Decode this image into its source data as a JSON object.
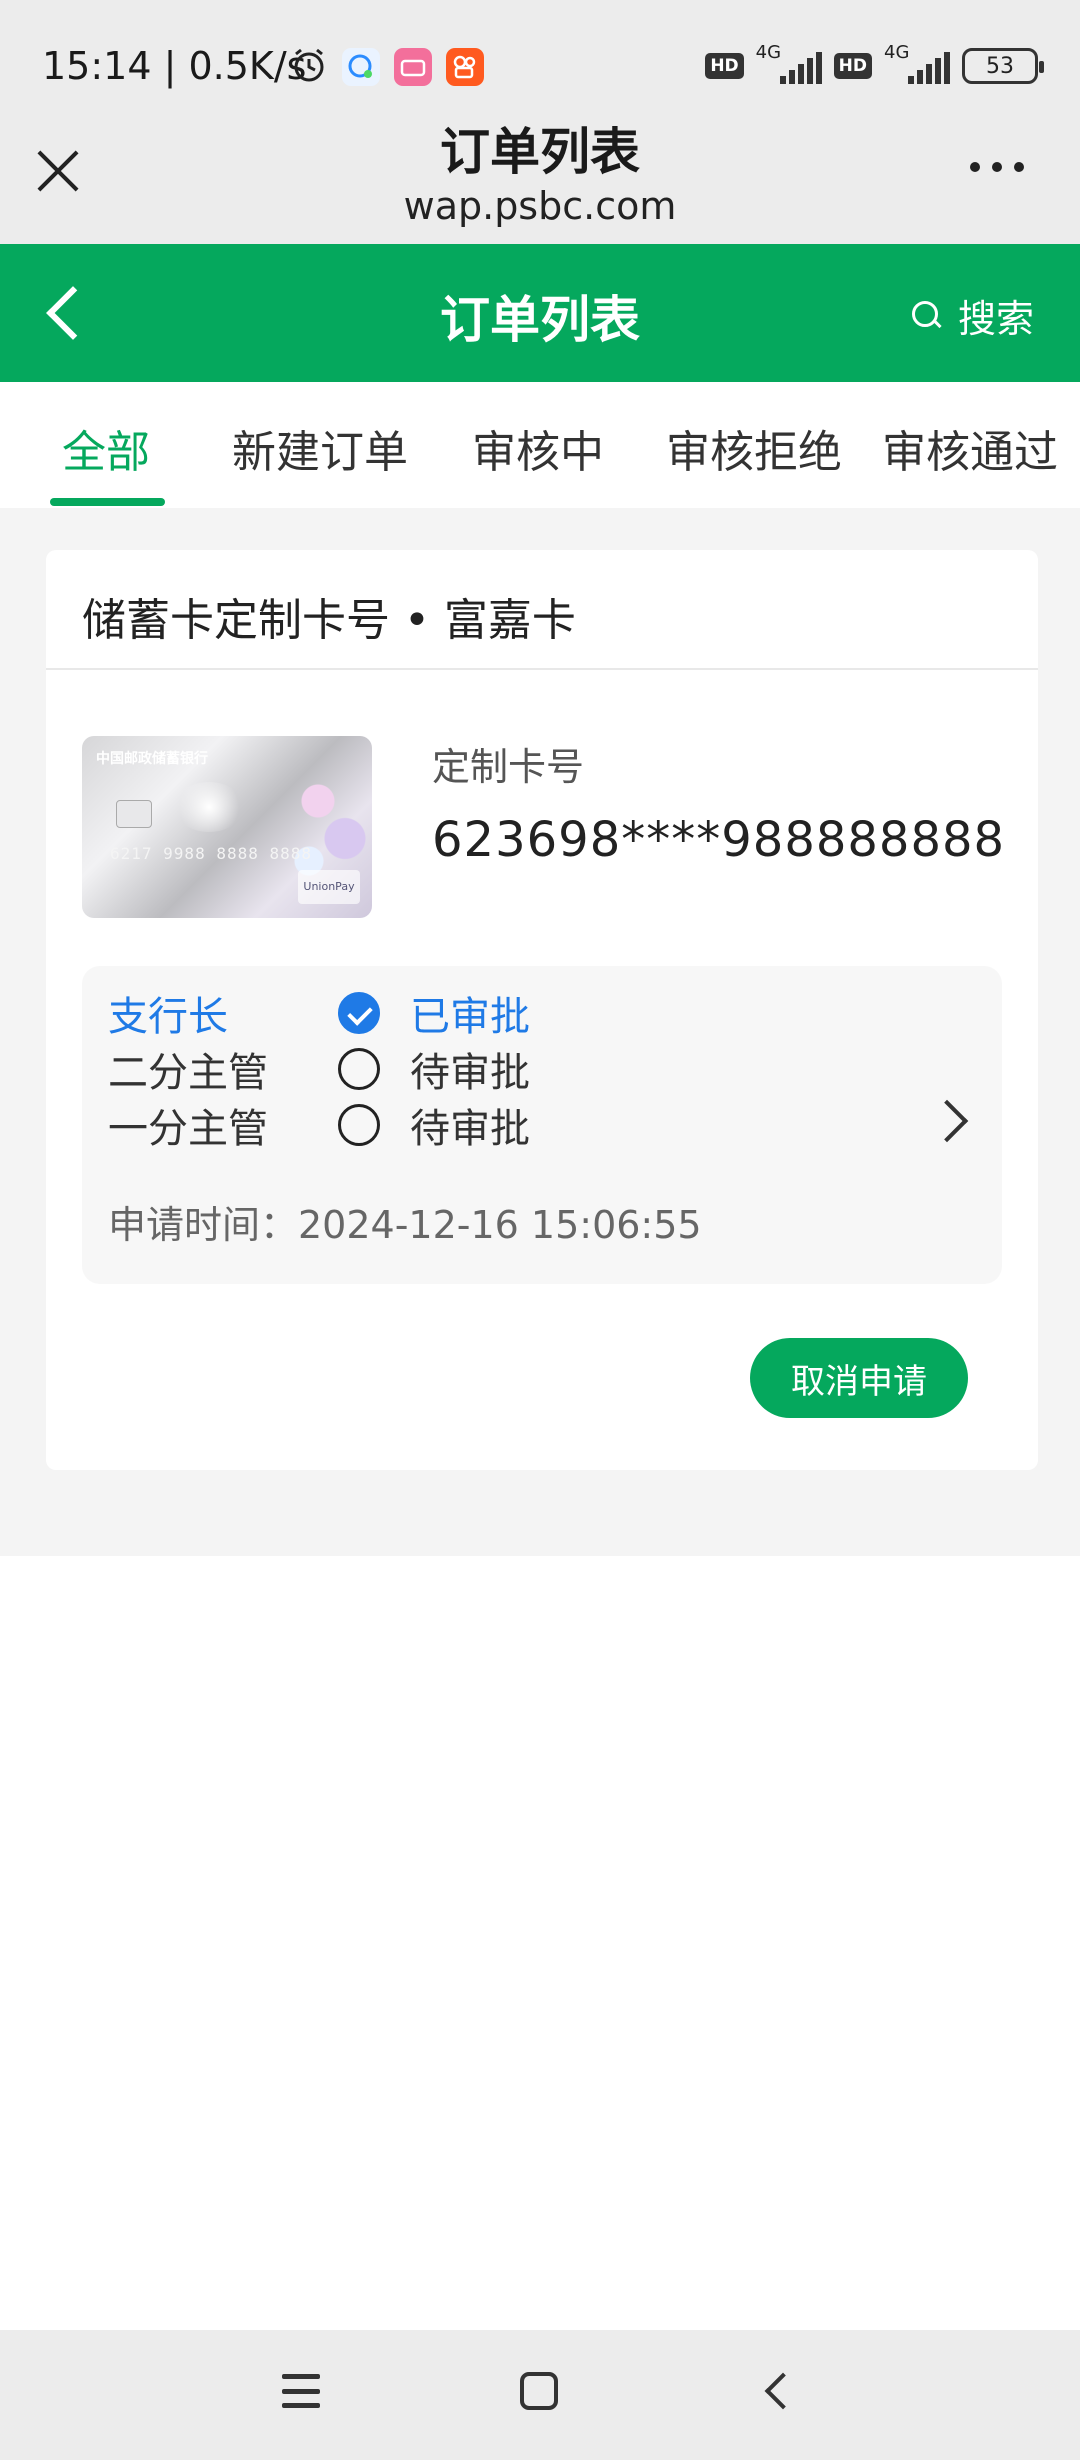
{
  "status_bar": {
    "time_speed": "15:14 | 0.5K/s",
    "network_1": "4G",
    "network_2": "4G",
    "hd_1": "HD",
    "hd_2": "HD",
    "battery": "53"
  },
  "browser": {
    "title": "订单列表",
    "url": "wap.psbc.com"
  },
  "app_bar": {
    "title": "订单列表",
    "search_label": "搜索"
  },
  "tabs": [
    {
      "label": "全部",
      "active": true
    },
    {
      "label": "新建订单",
      "active": false
    },
    {
      "label": "审核中",
      "active": false
    },
    {
      "label": "审核拒绝",
      "active": false
    },
    {
      "label": "审核通过",
      "active": false
    }
  ],
  "order": {
    "header": "储蓄卡定制卡号 • 富嘉卡",
    "card_image": {
      "bank_name": "中国邮政储蓄银行",
      "number_emboss": "6217 9988 8888 8888"
    },
    "field_label": "定制卡号",
    "card_number": "623698****988888888",
    "approvals": [
      {
        "role": "支行长",
        "status": "已审批",
        "approved": true
      },
      {
        "role": "二分主管",
        "status": "待审批",
        "approved": false
      },
      {
        "role": "一分主管",
        "status": "待审批",
        "approved": false
      }
    ],
    "apply_time": "申请时间：2024-12-16 15:06:55",
    "cancel_label": "取消申请"
  },
  "colors": {
    "brand_green": "#05a85d",
    "approved_blue": "#1f7ae6"
  }
}
